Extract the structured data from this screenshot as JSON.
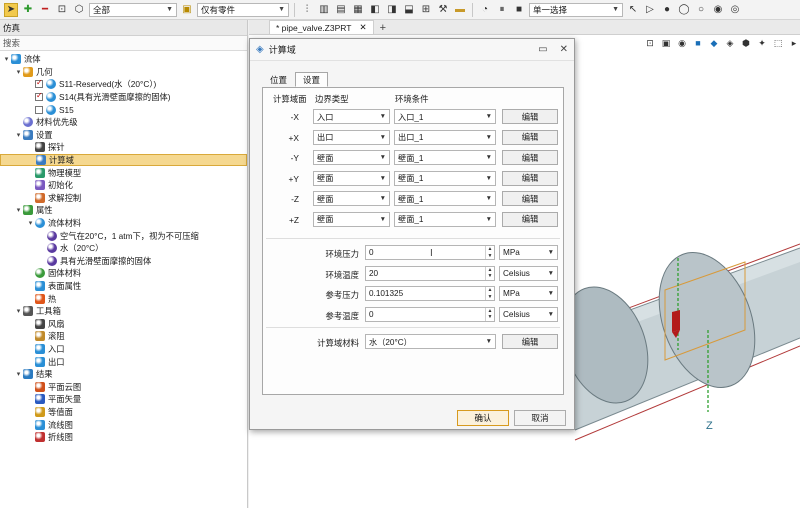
{
  "toolbar": {
    "filter_select": "全部",
    "scope_select": "仅有零件",
    "selection_mode": "单一选择"
  },
  "left_panel": {
    "title": "仿真",
    "search_label": "搜索",
    "tree": [
      {
        "label": "流体",
        "level": 0,
        "twisty": "open",
        "icon": "fluid-icon",
        "checkbox": null
      },
      {
        "label": "几何",
        "level": 1,
        "twisty": "open",
        "icon": "geometry-icon",
        "checkbox": null
      },
      {
        "label": "S11-Reserved(水（20°C）)",
        "level": 2,
        "twisty": "none",
        "icon": "body-icon",
        "checkbox": "on"
      },
      {
        "label": "S14(具有光滑壁面摩擦的固体)",
        "level": 2,
        "twisty": "none",
        "icon": "body-icon",
        "checkbox": "on"
      },
      {
        "label": "S15",
        "level": 2,
        "twisty": "none",
        "icon": "body-icon",
        "checkbox": "off"
      },
      {
        "label": "材料优先级",
        "level": 1,
        "twisty": "none",
        "icon": "material-priority-icon",
        "checkbox": null
      },
      {
        "label": "设置",
        "level": 1,
        "twisty": "open",
        "icon": "settings-icon",
        "checkbox": null
      },
      {
        "label": "探针",
        "level": 2,
        "twisty": "none",
        "icon": "probe-icon",
        "checkbox": null
      },
      {
        "label": "计算域",
        "level": 2,
        "twisty": "none",
        "icon": "domain-icon",
        "checkbox": null,
        "selected": true
      },
      {
        "label": "物理模型",
        "level": 2,
        "twisty": "none",
        "icon": "physics-icon",
        "checkbox": null
      },
      {
        "label": "初始化",
        "level": 2,
        "twisty": "none",
        "icon": "init-icon",
        "checkbox": null
      },
      {
        "label": "求解控制",
        "level": 2,
        "twisty": "none",
        "icon": "solver-icon",
        "checkbox": null
      },
      {
        "label": "属性",
        "level": 1,
        "twisty": "open",
        "icon": "properties-icon",
        "checkbox": null
      },
      {
        "label": "流体材料",
        "level": 2,
        "twisty": "open",
        "icon": "fluid-material-icon",
        "checkbox": null
      },
      {
        "label": "空气在20°C，1 atm下，视为不可压缩",
        "level": 3,
        "twisty": "none",
        "icon": "material-icon",
        "checkbox": null
      },
      {
        "label": "水（20°C）",
        "level": 3,
        "twisty": "none",
        "icon": "material-icon",
        "checkbox": null
      },
      {
        "label": "具有光滑壁面摩擦的固体",
        "level": 3,
        "twisty": "none",
        "icon": "material-icon",
        "checkbox": null
      },
      {
        "label": "固体材料",
        "level": 2,
        "twisty": "none",
        "icon": "solid-material-icon",
        "checkbox": null
      },
      {
        "label": "表面属性",
        "level": 2,
        "twisty": "none",
        "icon": "surface-icon",
        "checkbox": null
      },
      {
        "label": "热",
        "level": 2,
        "twisty": "none",
        "icon": "heat-icon",
        "checkbox": null
      },
      {
        "label": "工具箱",
        "level": 1,
        "twisty": "open",
        "icon": "toolbox-icon",
        "checkbox": null
      },
      {
        "label": "风扇",
        "level": 2,
        "twisty": "none",
        "icon": "fan-icon",
        "checkbox": null
      },
      {
        "label": "滚阻",
        "level": 2,
        "twisty": "none",
        "icon": "resistance-icon",
        "checkbox": null
      },
      {
        "label": "入口",
        "level": 2,
        "twisty": "none",
        "icon": "inlet-icon",
        "checkbox": null
      },
      {
        "label": "出口",
        "level": 2,
        "twisty": "none",
        "icon": "outlet-icon",
        "checkbox": null
      },
      {
        "label": "结果",
        "level": 1,
        "twisty": "open",
        "icon": "results-icon",
        "checkbox": null
      },
      {
        "label": "平面云图",
        "level": 2,
        "twisty": "none",
        "icon": "contour-icon",
        "checkbox": null
      },
      {
        "label": "平面矢量",
        "level": 2,
        "twisty": "none",
        "icon": "vector-icon",
        "checkbox": null
      },
      {
        "label": "等值面",
        "level": 2,
        "twisty": "none",
        "icon": "isosurface-icon",
        "checkbox": null
      },
      {
        "label": "流线图",
        "level": 2,
        "twisty": "none",
        "icon": "streamline-icon",
        "checkbox": null
      },
      {
        "label": "折线图",
        "level": 2,
        "twisty": "none",
        "icon": "line-chart-icon",
        "checkbox": null
      }
    ]
  },
  "doc_tab": {
    "label": "* pipe_valve.Z3PRT",
    "close": "✕",
    "add": "+"
  },
  "viewport": {
    "axis_label": "Z"
  },
  "dialog": {
    "title": "计算域",
    "tabs": [
      "位置",
      "设置"
    ],
    "active_tab": 1,
    "headers": {
      "face": "计算域面",
      "boundary": "边界类型",
      "env": "环境条件"
    },
    "rows": [
      {
        "face": "-X",
        "boundary": "入口",
        "env": "入口_1",
        "edit": "编辑"
      },
      {
        "face": "+X",
        "boundary": "出口",
        "env": "出口_1",
        "edit": "编辑"
      },
      {
        "face": "-Y",
        "boundary": "壁面",
        "env": "壁面_1",
        "edit": "编辑"
      },
      {
        "face": "+Y",
        "boundary": "壁面",
        "env": "壁面_1",
        "edit": "编辑"
      },
      {
        "face": "-Z",
        "boundary": "壁面",
        "env": "壁面_1",
        "edit": "编辑"
      },
      {
        "face": "+Z",
        "boundary": "壁面",
        "env": "壁面_1",
        "edit": "编辑"
      }
    ],
    "params": [
      {
        "label": "环境压力",
        "value": "0",
        "unit": "MPa"
      },
      {
        "label": "环境温度",
        "value": "20",
        "unit": "Celsius"
      },
      {
        "label": "参考压力",
        "value": "0.101325",
        "unit": "MPa"
      },
      {
        "label": "参考温度",
        "value": "0",
        "unit": "Celsius"
      }
    ],
    "material": {
      "label": "计算域材料",
      "value": "水（20°C）",
      "edit": "编辑"
    },
    "ok": "确认",
    "cancel": "取消"
  }
}
